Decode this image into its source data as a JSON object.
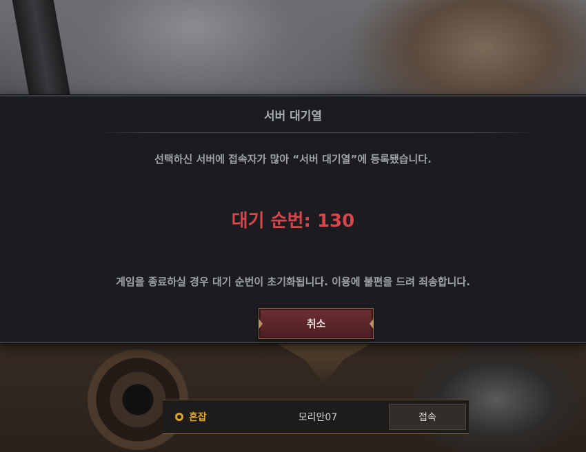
{
  "dialog": {
    "title": "서버 대기열",
    "message": "선택하신 서버에 접속자가 많아 “서버 대기열”에 등록됐습니다.",
    "queue_label": "대기 순번: ",
    "queue_number": "130",
    "notice": "게임을 종료하실 경우 대기 순번이 초기화됩니다. 이용에 불편을 드려 죄송합니다.",
    "cancel_label": "취소"
  },
  "server_bar": {
    "status_icon": "busy-status-icon",
    "status_label": "혼잡",
    "server_name": "모리안07",
    "connect_label": "접속"
  },
  "colors": {
    "queue_number": "#d8454a",
    "status": "#e0a52a",
    "cancel_button": "#5a2428"
  }
}
